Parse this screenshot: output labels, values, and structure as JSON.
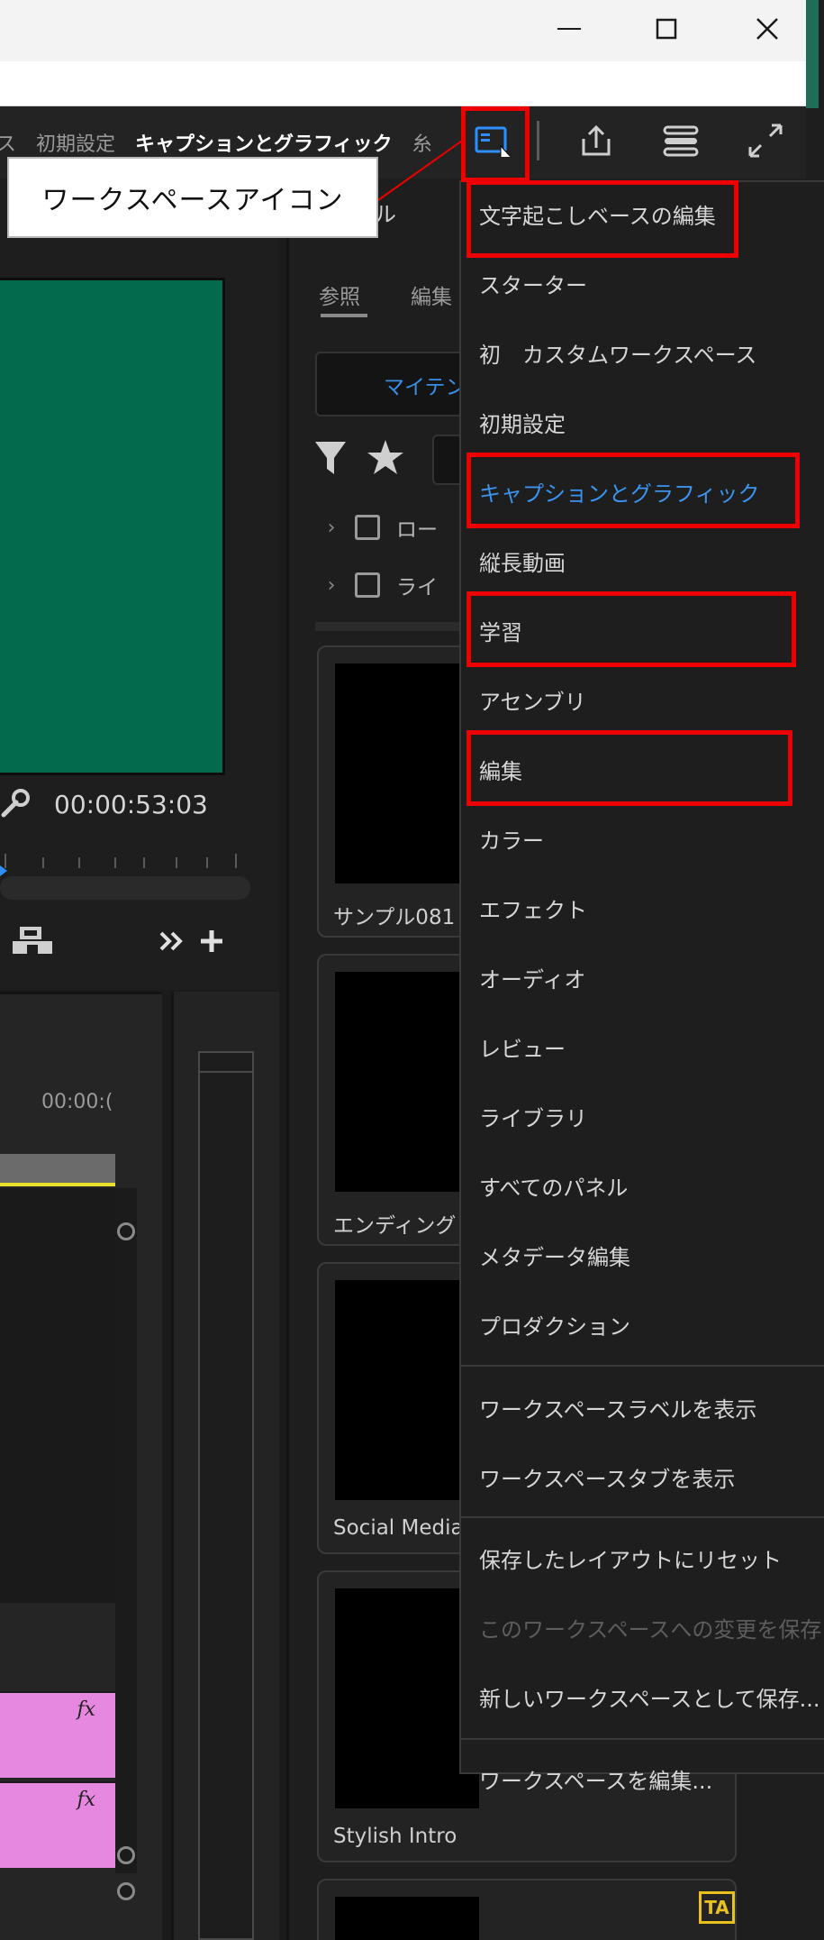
{
  "window": {
    "minimize_glyph": "—",
    "maximize_glyph": "☐",
    "close_glyph": "✕"
  },
  "header": {
    "workspace_tabs": [
      {
        "label": "ス"
      },
      {
        "label": "初期設定"
      },
      {
        "label": "キャプションとグラフィック",
        "active": true
      },
      {
        "label": "糸"
      }
    ],
    "icons": [
      "workspaces-icon",
      "share-icon",
      "quick-settings-icon",
      "fullscreen-icon"
    ]
  },
  "callout": {
    "text": "ワークスペースアイコン"
  },
  "program_monitor": {
    "timecode": "00:00:53:03",
    "controls": [
      "export-frame-icon",
      ">>",
      "+"
    ]
  },
  "timeline": {
    "time_label": "00:00:(",
    "clip_fx": "fx"
  },
  "essential_graphics": {
    "tab_label": "ンシャル",
    "subtabs": [
      "参照",
      "編集"
    ],
    "dropdown_text": "マイテン",
    "rows": [
      {
        "chevron": "›",
        "label": "ロー"
      },
      {
        "chevron": "›",
        "label": "ライ"
      }
    ],
    "cards": [
      {
        "label": "サンプル081"
      },
      {
        "label": "エンディング"
      },
      {
        "label": "Social Media"
      },
      {
        "label": "Stylish Intro"
      }
    ],
    "badge": "TA"
  },
  "menu": {
    "items": [
      {
        "label": "文字起こしベースの編集"
      },
      {
        "label": "スターター"
      },
      {
        "label": "初　カスタムワークスペース"
      },
      {
        "label": "初期設定"
      },
      {
        "label": "キャプションとグラフィック",
        "selected": true
      },
      {
        "label": "縦長動画"
      },
      {
        "label": "学習"
      },
      {
        "label": "アセンブリ"
      },
      {
        "label": "編集"
      },
      {
        "label": "カラー"
      },
      {
        "label": "エフェクト"
      },
      {
        "label": "オーディオ"
      },
      {
        "label": "レビュー"
      },
      {
        "label": "ライブラリ"
      },
      {
        "label": "すべてのパネル"
      },
      {
        "label": "メタデータ編集"
      },
      {
        "label": "プロダクション"
      },
      {
        "label": "ワークスペースラベルを表示"
      },
      {
        "label": "ワークスペースタブを表示"
      },
      {
        "label": "保存したレイアウトにリセット"
      },
      {
        "label": "このワークスペースへの変更を保存",
        "disabled": true
      },
      {
        "label": "新しいワークスペースとして保存..."
      },
      {
        "label": "ワークスペースを編集..."
      }
    ]
  },
  "colors": {
    "accent_blue": "#3a94f0",
    "highlight_red": "#ee0000",
    "video_green": "#046a4d",
    "clip_pink": "#e687e0"
  }
}
